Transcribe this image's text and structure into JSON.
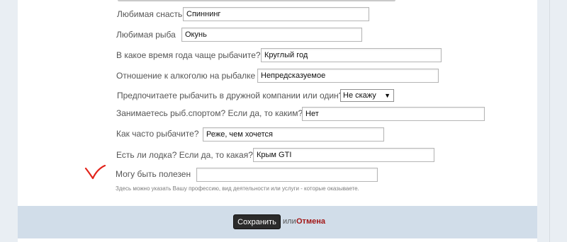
{
  "form": {
    "fields": [
      {
        "label": "Любимая снасть",
        "value": "Спиннинг"
      },
      {
        "label": "Любимая рыба",
        "value": "Окунь"
      },
      {
        "label": "В какое время года чаще рыбачите?",
        "value": "Круглый год"
      },
      {
        "label": "Отношение к алкоголю на рыбалке",
        "value": "Непредсказуемое"
      },
      {
        "label": "Предпочитаете рыбачить в дружной компании или один?",
        "value": "Не скажу",
        "arrow": "▼"
      },
      {
        "label": "Занимаетесь рыб.спортом? Если да, то каким?",
        "value": "Нет"
      },
      {
        "label": "Как часто рыбачите?",
        "value": "Реже, чем хочется"
      },
      {
        "label": "Есть ли лодка? Если да, то какая?",
        "value": "Крым GTI"
      },
      {
        "label": "Могу быть полезен",
        "value": ""
      }
    ],
    "hint": "Здесь можно указать Вашу профессию, вид деятельности или услуги - которые оказываете."
  },
  "footer": {
    "save_label": "Сохранить",
    "or_text": "или",
    "cancel_label": "Отмена"
  },
  "colors": {
    "accent_cancel": "#a21616",
    "save_button_bg": "#2b2b2b",
    "footer_bg": "#d1dde9",
    "checkmark": "#e2231a"
  }
}
